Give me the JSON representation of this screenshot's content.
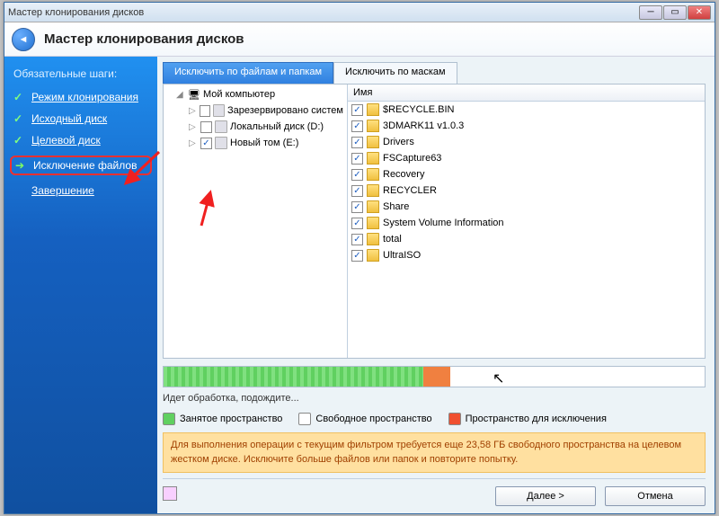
{
  "window": {
    "title": "Мастер клонирования дисков"
  },
  "header": {
    "title": "Мастер клонирования дисков"
  },
  "sidebar": {
    "heading": "Обязательные шаги:",
    "steps": [
      {
        "label": "Режим клонирования",
        "done": true
      },
      {
        "label": "Исходный диск",
        "done": true
      },
      {
        "label": "Целевой диск",
        "done": true
      },
      {
        "label": "Исключение файлов",
        "current": true
      },
      {
        "label": "Завершение",
        "done": false
      }
    ]
  },
  "tabs": {
    "active": "Исключить по файлам и папкам",
    "other": "Исключить по маскам"
  },
  "tree": {
    "root": "Мой компьютер",
    "items": [
      {
        "label": "Зарезервировано систем",
        "checked": false
      },
      {
        "label": "Локальный диск (D:)",
        "checked": false
      },
      {
        "label": "Новый том (E:)",
        "checked": true,
        "highlighted": true
      }
    ]
  },
  "list": {
    "header": "Имя",
    "rows": [
      "$RECYCLE.BIN",
      "3DMARK11 v1.0.3",
      "Drivers",
      "FSCapture63",
      "Recovery",
      "RECYCLER",
      "Share",
      "System Volume Information",
      "total",
      "UltraISO"
    ]
  },
  "progress": {
    "used_pct": 48,
    "excl_pct": 5,
    "processing": "Идет обработка, подождите..."
  },
  "legend": {
    "used": "Занятое пространство",
    "free": "Свободное пространство",
    "excl": "Пространство для исключения"
  },
  "warning": "Для выполнения операции с текущим фильтром требуется еще 23,58 ГБ свободного пространства на целевом жестком диске. Исключите больше файлов или папок и повторите попытку.",
  "buttons": {
    "next": "Далее >",
    "cancel": "Отмена"
  }
}
